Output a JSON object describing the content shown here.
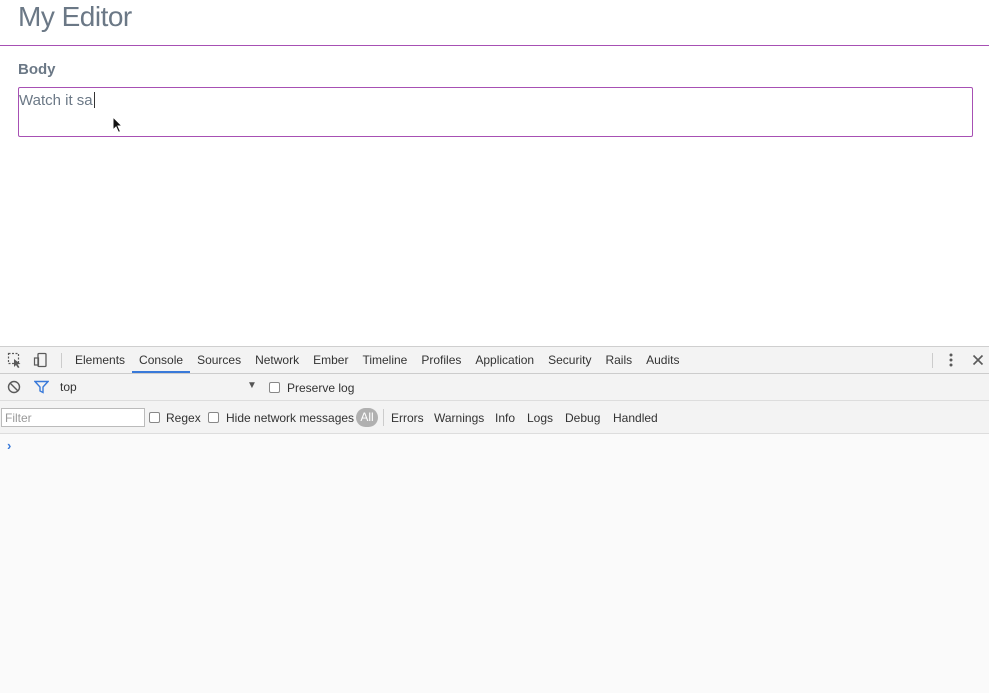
{
  "app": {
    "title": "My Editor",
    "field_label": "Body",
    "editor_value": "Watch it sa"
  },
  "devtools": {
    "tabs": [
      {
        "label": "Elements",
        "active": false
      },
      {
        "label": "Console",
        "active": true
      },
      {
        "label": "Sources",
        "active": false
      },
      {
        "label": "Network",
        "active": false
      },
      {
        "label": "Ember",
        "active": false
      },
      {
        "label": "Timeline",
        "active": false
      },
      {
        "label": "Profiles",
        "active": false
      },
      {
        "label": "Application",
        "active": false
      },
      {
        "label": "Security",
        "active": false
      },
      {
        "label": "Rails",
        "active": false
      },
      {
        "label": "Audits",
        "active": false
      }
    ],
    "context": "top",
    "preserve_log_label": "Preserve log",
    "filter_placeholder": "Filter",
    "regex_label": "Regex",
    "hide_network_label": "Hide network messages",
    "levels": {
      "all": "All",
      "errors": "Errors",
      "warnings": "Warnings",
      "info": "Info",
      "logs": "Logs",
      "debug": "Debug",
      "handled": "Handled"
    },
    "prompt": "›",
    "colors": {
      "accent": "#3879d9",
      "editor_border": "#a750b4"
    },
    "icons": [
      "inspect-element-icon",
      "device-mode-icon",
      "more-options-icon",
      "close-icon",
      "clear-console-icon",
      "filter-icon"
    ]
  }
}
